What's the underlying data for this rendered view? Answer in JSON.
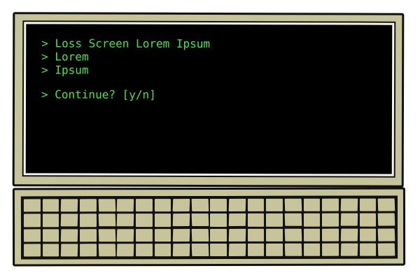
{
  "colors": {
    "casing": "#c8c49a",
    "screen_bg": "#000000",
    "terminal_text": "#3ee83e"
  },
  "terminal": {
    "lines": [
      "> Loss Screen Lorem Ipsum",
      "> Lorem",
      "> Ipsum"
    ],
    "prompt": "> Continue? [y/n]"
  },
  "keyboard": {
    "rows": 4,
    "keys_per_row": 20
  }
}
